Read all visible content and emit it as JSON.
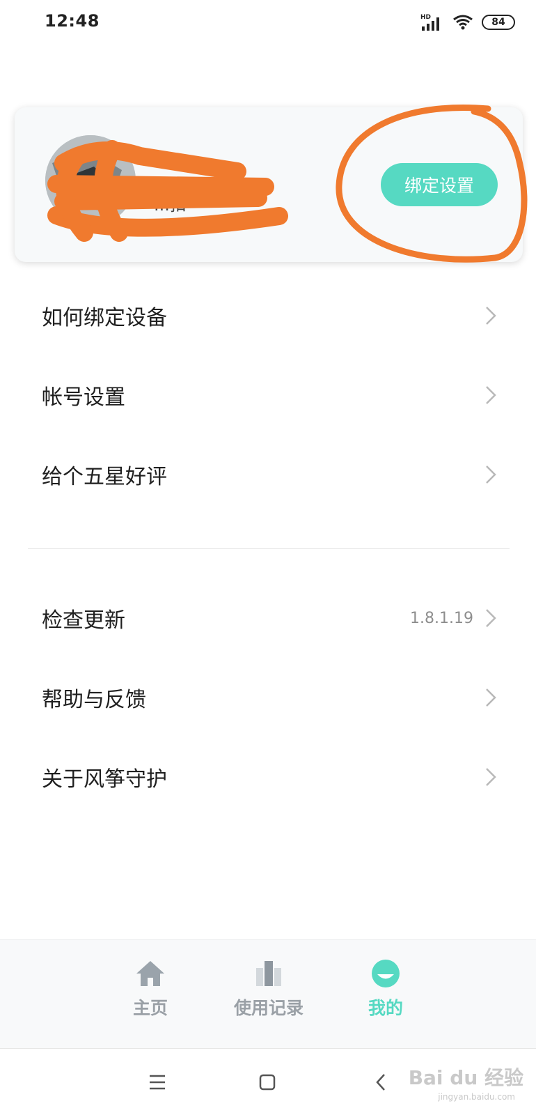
{
  "status_bar": {
    "time": "12:48",
    "network": "HD",
    "battery": "84",
    "icons": [
      "signal-icon",
      "wifi-icon",
      "battery-icon"
    ]
  },
  "profile": {
    "name_fragment": "...扣",
    "bind_button_label": "绑定设置",
    "accent_color": "#56d9c2",
    "annotation_color": "#f07a2e"
  },
  "menu_group_1": [
    {
      "label": "如何绑定设备"
    },
    {
      "label": "帐号设置"
    },
    {
      "label": "给个五星好评"
    }
  ],
  "menu_group_2": [
    {
      "label": "检查更新",
      "value": "1.8.1.19"
    },
    {
      "label": "帮助与反馈"
    },
    {
      "label": "关于风筝守护"
    }
  ],
  "tabs": [
    {
      "label": "主页",
      "icon": "home-icon"
    },
    {
      "label": "使用记录",
      "icon": "bar-chart-icon"
    },
    {
      "label": "我的",
      "icon": "profile-icon",
      "active": true
    }
  ],
  "nav": {
    "buttons": [
      "menu-icon",
      "home-square-icon",
      "back-icon"
    ]
  },
  "watermark": {
    "text": "Bai du 经验",
    "sub": "jingyan.baidu.com"
  }
}
